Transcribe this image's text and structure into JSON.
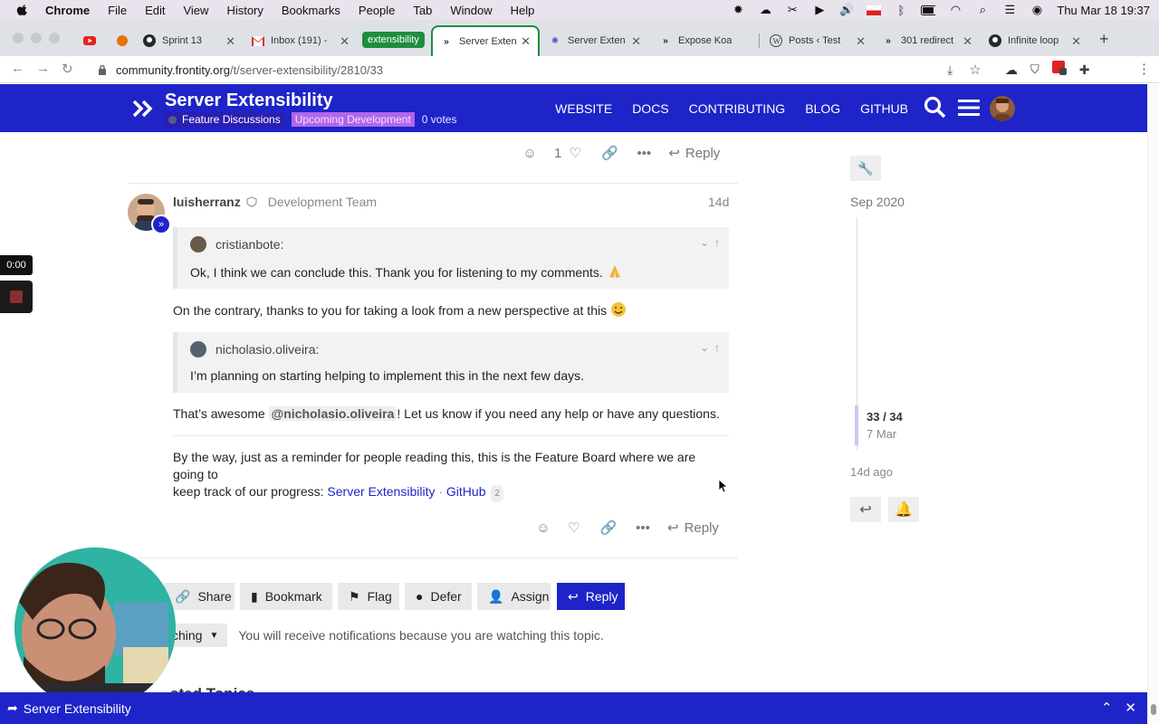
{
  "menubar": {
    "app": "Chrome",
    "items": [
      "File",
      "Edit",
      "View",
      "History",
      "Bookmarks",
      "People",
      "Tab",
      "Window",
      "Help"
    ],
    "clock": "Thu Mar 18  19:37"
  },
  "tabs": [
    {
      "title": "",
      "icon": "youtube-icon"
    },
    {
      "title": "",
      "icon": "orange-dot-icon"
    },
    {
      "title": "Sprint 13",
      "icon": "github-icon"
    },
    {
      "title": "Inbox (191) -",
      "icon": "gmail-icon"
    },
    {
      "title": "Server Exten",
      "icon": "frontity-icon"
    },
    {
      "title": "Server Exten",
      "icon": "gear-purple-icon"
    },
    {
      "title": "Expose Koa",
      "icon": "frontity-icon"
    },
    {
      "title": "Posts ‹ Test",
      "icon": "wordpress-icon"
    },
    {
      "title": "301 redirect",
      "icon": "frontity-icon"
    },
    {
      "title": "Infinite loop",
      "icon": "github-icon"
    }
  ],
  "tab_group_label": "extensibility",
  "address": {
    "host": "community.frontity.org",
    "path": "/t/server-extensibility/2810/33"
  },
  "header": {
    "title": "Server Extensibility",
    "category": "Feature Discussions",
    "tag": "Upcoming Development",
    "votes": "0 votes",
    "nav": [
      "WEBSITE",
      "DOCS",
      "CONTRIBUTING",
      "BLOG",
      "GITHUB"
    ]
  },
  "prev_post": {
    "likes": "1",
    "reply_label": "Reply"
  },
  "post": {
    "username": "luisherranz",
    "group": "Development Team",
    "date": "14d",
    "quote1": {
      "author": "cristianbote:",
      "text": "Ok, I think we can conclude this. Thank you for listening to my comments."
    },
    "para1": "On the contrary, thanks to you for taking a look from a new perspective at this",
    "quote2": {
      "author": "nicholasio.oliveira:",
      "text": "I’m planning on starting helping to implement this in the next few days."
    },
    "para2_before": "That’s awesome",
    "mention": "@nicholasio.oliveira",
    "para2_after": "! Let us know if you need any help or have any questions.",
    "para3_line1": "By the way, just as a reminder for people reading this, this is the Feature Board where we are going to",
    "para3_line2": "keep track of our progress:",
    "link1": "Server Extensibility",
    "sep": "·",
    "link2": "GitHub",
    "link2_count": "2",
    "reply_label": "Reply"
  },
  "footer_buttons": [
    "Share",
    "Bookmark",
    "Flag",
    "Defer",
    "Assign",
    "Reply"
  ],
  "notifications": {
    "level": "ching",
    "text": "You will receive notifications because you are watching this topic."
  },
  "timeline": {
    "start": "Sep 2020",
    "position": "33 / 34",
    "position_date": "7 Mar",
    "end": "14d ago"
  },
  "recorder": {
    "time": "0:00"
  },
  "related_peek": "ated Topics",
  "bottom_bar": {
    "title": "Server Extensibility"
  },
  "colors": {
    "brand": "#1e24c8",
    "tag": "#b266e8",
    "group": "#1e8e3e"
  }
}
